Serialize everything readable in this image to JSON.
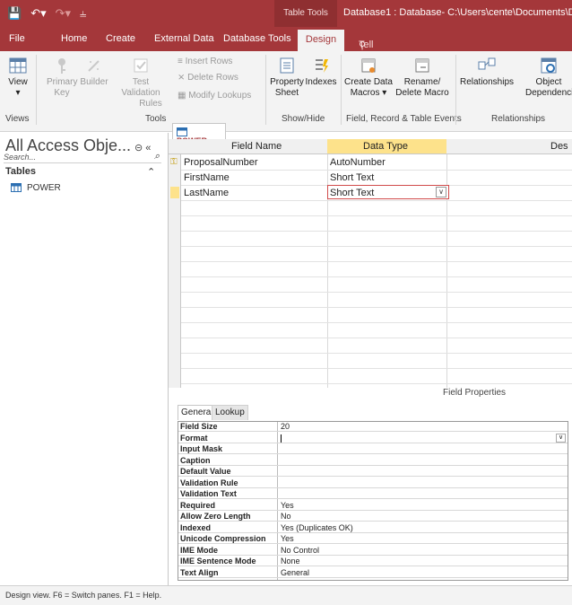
{
  "titlebar": {
    "table_tools": "Table Tools",
    "title": "Database1 : Database- C:\\Users\\cente\\Documents\\Dat",
    "accent": "#a4373a"
  },
  "tabs": [
    "File",
    "Home",
    "Create",
    "External Data",
    "Database Tools",
    "Design"
  ],
  "tell_me": "Tell me what you want to do",
  "ribbon": {
    "view": "View",
    "primary_key": [
      "Primary",
      "Key"
    ],
    "builder": "Builder",
    "test_validation": [
      "Test Validation",
      "Rules"
    ],
    "insert_rows": "Insert Rows",
    "delete_rows": "Delete Rows",
    "modify_lookups": "Modify Lookups",
    "property_sheet": [
      "Property",
      "Sheet"
    ],
    "indexes": "Indexes",
    "create_data_macros": [
      "Create Data",
      "Macros ▾"
    ],
    "rename_delete_macro": [
      "Rename/",
      "Delete Macro"
    ],
    "relationships": "Relationships",
    "object_dependencies": [
      "Object",
      "Dependencies"
    ],
    "groups": [
      "Views",
      "Tools",
      "Show/Hide",
      "Field, Record & Table Events",
      "Relationships"
    ]
  },
  "nav": {
    "title": "All Access Obje...",
    "search_placeholder": "Search...",
    "section": "Tables",
    "items": [
      "POWER"
    ]
  },
  "doc_tab": "POWER",
  "grid": {
    "headers": [
      "Field Name",
      "Data Type",
      "Des"
    ],
    "rows": [
      {
        "name": "ProposalNumber",
        "type": "AutoNumber",
        "key": true
      },
      {
        "name": "FirstName",
        "type": "Short Text",
        "key": false
      },
      {
        "name": "LastName",
        "type": "Short Text",
        "key": false,
        "active": true
      }
    ]
  },
  "field_properties_label": "Field Properties",
  "prop_tabs": [
    "General",
    "Lookup"
  ],
  "properties": [
    {
      "k": "Field Size",
      "v": "20"
    },
    {
      "k": "Format",
      "v": ""
    },
    {
      "k": "Input Mask",
      "v": ""
    },
    {
      "k": "Caption",
      "v": ""
    },
    {
      "k": "Default Value",
      "v": ""
    },
    {
      "k": "Validation Rule",
      "v": ""
    },
    {
      "k": "Validation Text",
      "v": ""
    },
    {
      "k": "Required",
      "v": "Yes"
    },
    {
      "k": "Allow Zero Length",
      "v": "No"
    },
    {
      "k": "Indexed",
      "v": "Yes (Duplicates OK)"
    },
    {
      "k": "Unicode Compression",
      "v": "Yes"
    },
    {
      "k": "IME Mode",
      "v": "No Control"
    },
    {
      "k": "IME Sentence Mode",
      "v": "None"
    },
    {
      "k": "Text Align",
      "v": "General"
    }
  ],
  "status": "Design view.  F6 = Switch panes.  F1 = Help."
}
